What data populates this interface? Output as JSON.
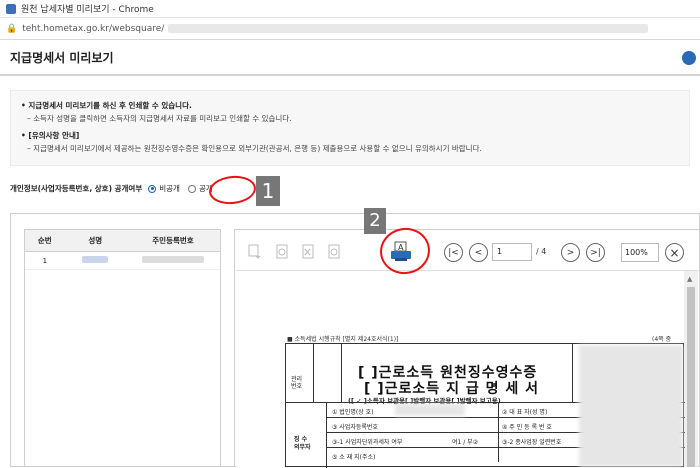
{
  "window": {
    "title": "원천 납세자별 미리보기 - Chrome"
  },
  "address": {
    "url": "teht.hometax.go.kr/websquare/"
  },
  "page": {
    "title": "지급명세서 미리보기"
  },
  "notice": {
    "line1": "지급명세서 미리보기를 하신 후 인쇄할 수 있습니다.",
    "line2": "소득자 성명을 클릭하면 소득자의 지급명세서 자료를 미리보고 인쇄할 수 있습니다.",
    "line3": "[유의사항 안내]",
    "line4": "지급명세서 미리보기에서 제공하는 원천징수영수증은 확인용으로 외부기관(관공서, 은행 등) 제출용으로 사용할 수 없으니 유의하시기 바랍니다."
  },
  "privacy": {
    "label": "개인정보(사업자등록번호, 상호) 공개여부",
    "private": "비공개",
    "public": "공개"
  },
  "badges": {
    "one": "1",
    "two": "2"
  },
  "list": {
    "headers": [
      "순번",
      "성명",
      "주민등록번호"
    ],
    "rows": [
      {
        "no": "1"
      }
    ]
  },
  "viewer": {
    "page_current": "1",
    "page_total": "/ 4",
    "zoom": "100%",
    "nav_first": "|<",
    "nav_prev": "<",
    "nav_next": ">",
    "nav_last": ">|",
    "close": "×"
  },
  "form": {
    "top_label": "■ 소득세법 시행규칙 [별지 제24호서식(1)]",
    "page_no": "(4쪽 중",
    "title1": "[ ]근로소득 원천징수영수증",
    "title2": "[ ]근로소득 지 급 명 세 서",
    "sub": "([ ✓ ]소득자 보관용[ ]발행자 보관용[ ]발행자 보고용)",
    "mgmt": "관리\n번호",
    "side": "징 수\n의무자",
    "f1": "① 법인명(상 호)",
    "f2": "② 대 표 자(성 명)",
    "f3": "③ 사업자등록번호",
    "f4": "④ 주 민 등 록 번 호",
    "f5": "③-1 사업자단위과세자 여부",
    "f6": "여1 / 부②",
    "f7": "③-2 종사업장 일련번호",
    "f8": "⑤ 소 재 지(주소)"
  }
}
